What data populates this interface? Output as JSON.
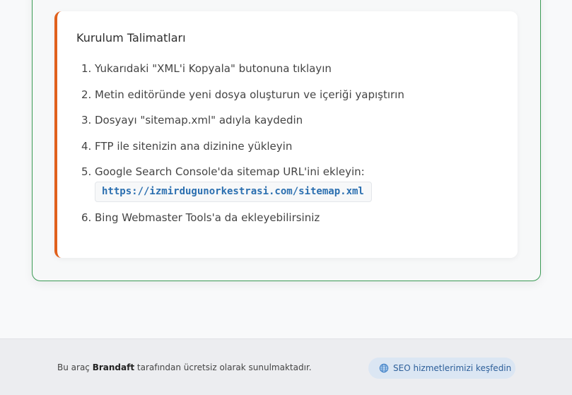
{
  "instructions": {
    "title": "Kurulum Talimatları",
    "steps": [
      {
        "num": "1.",
        "text": "Yukarıdaki \"XML'i Kopyala\" butonuna tıklayın"
      },
      {
        "num": "2.",
        "text": "Metin editöründe yeni dosya oluşturun ve içeriği yapıştırın"
      },
      {
        "num": "3.",
        "text": "Dosyayı \"sitemap.xml\" adıyla kaydedin"
      },
      {
        "num": "4.",
        "text": "FTP ile sitenizin ana dizinine yükleyin"
      },
      {
        "num": "5.",
        "text": "Google Search Console'da sitemap URL'ini ekleyin:",
        "code": "https://izmirdugunorkestrasi.com/sitemap.xml"
      },
      {
        "num": "6.",
        "text": "Bing Webmaster Tools'a da ekleyebilirsiniz"
      }
    ]
  },
  "footer": {
    "text_before": "Bu araç ",
    "brand": "Brandaft",
    "text_after": " tarafından ücretsiz olarak sunulmaktadır.",
    "seo_button_label": "SEO hizmetlerimizi keşfedin",
    "seo_button_icon": "globe-icon"
  },
  "colors": {
    "accent_border": "#e0601c",
    "card_border": "#3b9b55",
    "link": "#2b6fb0"
  }
}
